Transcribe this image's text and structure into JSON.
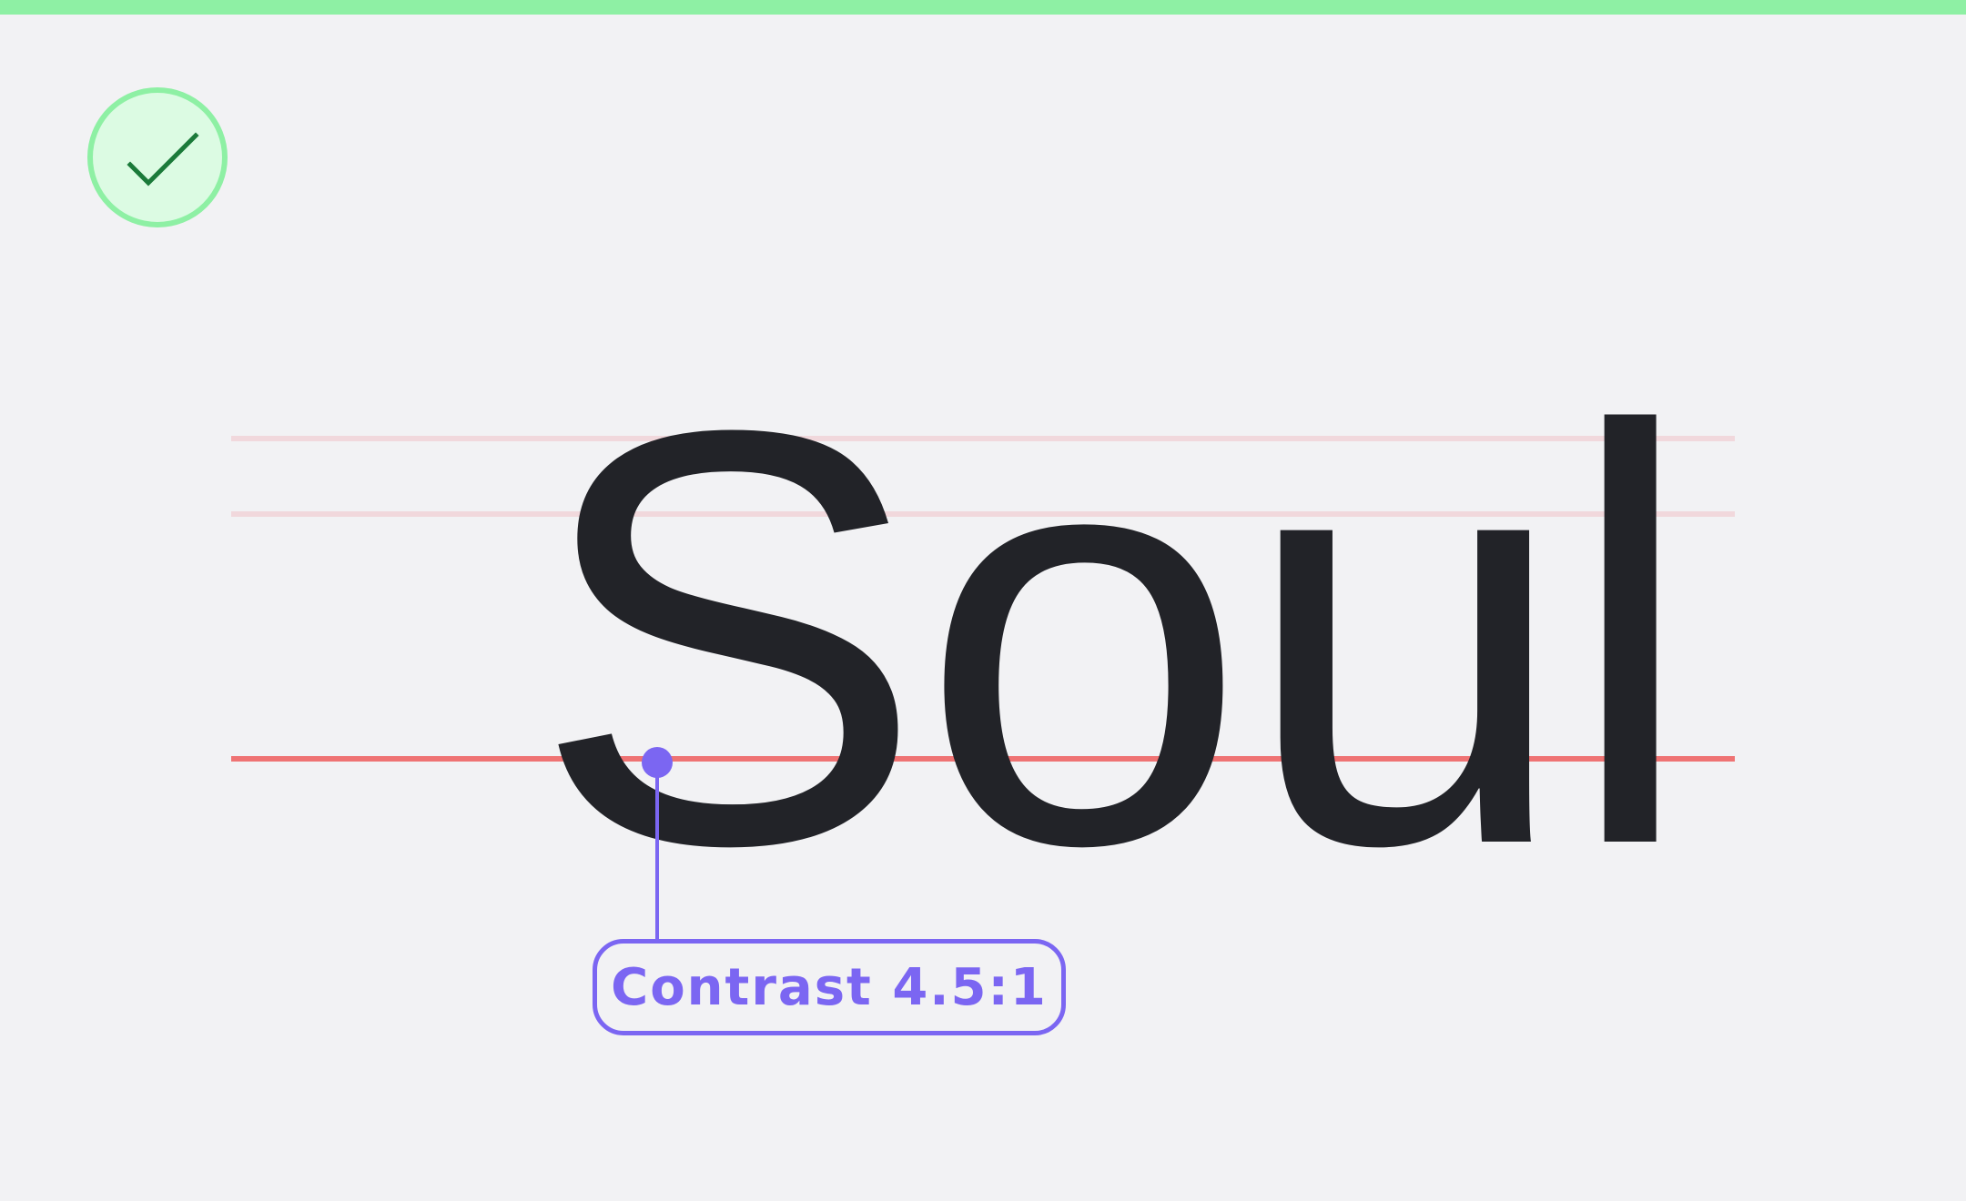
{
  "specimen": {
    "word": "Soul"
  },
  "callout": {
    "label": "Contrast 4.5:1"
  },
  "status": {
    "icon": "checkmark-icon",
    "state": "pass"
  },
  "colors": {
    "background": "#f2f2f4",
    "top_bar": "#8ef0a4",
    "badge_fill": "#dcfbe3",
    "badge_border": "#8ef0a4",
    "checkmark": "#1b7a3a",
    "text": "#222328",
    "guide_faint": "#f1d8dc",
    "guide_baseline": "#ef7373",
    "accent": "#7b66f2"
  }
}
